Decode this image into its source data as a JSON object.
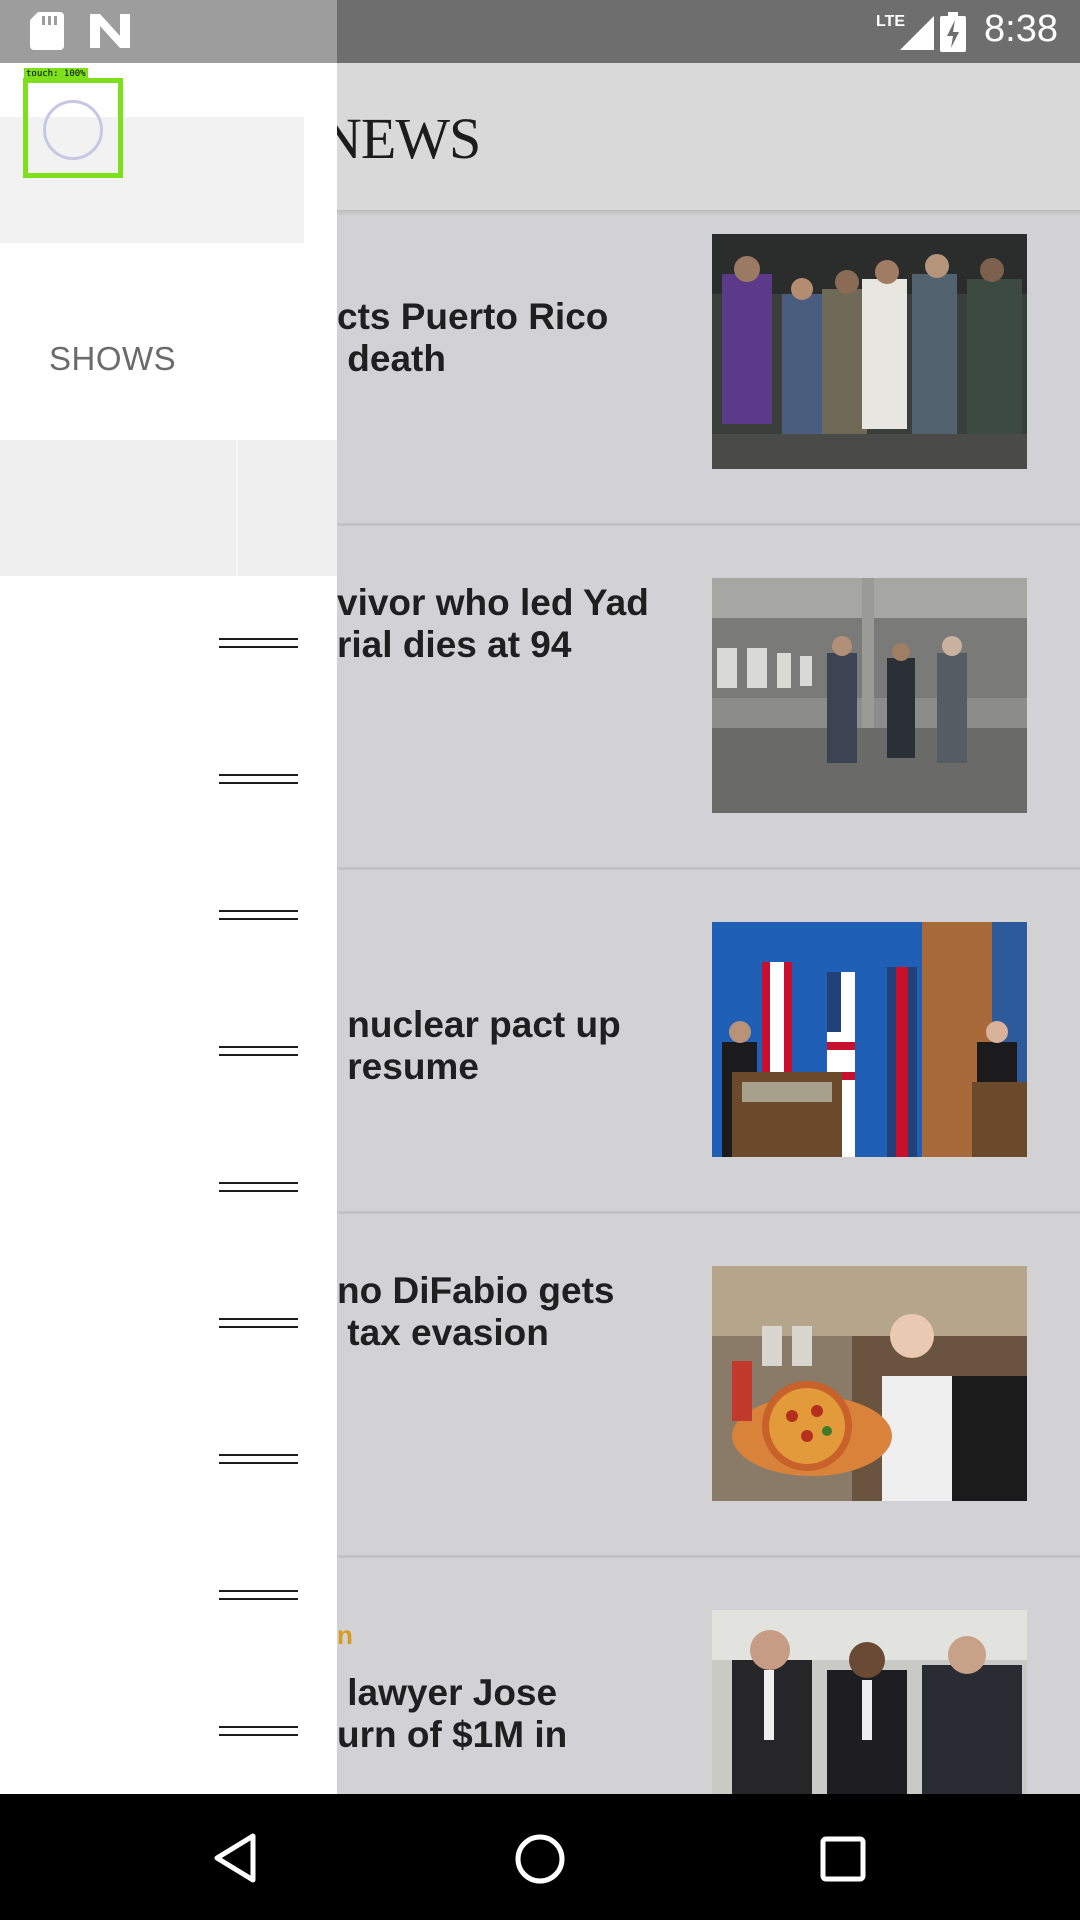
{
  "status_bar": {
    "time": "8:38",
    "network_label": "LTE",
    "icons": [
      "sd-card-icon",
      "n-logo-icon",
      "signal-icon",
      "battery-charging-icon"
    ]
  },
  "app": {
    "logo_text": "NEWS",
    "articles": [
      {
        "title": "cts Puerto Rico\n death",
        "tag": "",
        "image": "photo-crowd-embrace"
      },
      {
        "title": "vivor who led Yad\nrial dies at 94",
        "tag": "",
        "image": "photo-warehouse-men"
      },
      {
        "title": " nuclear pact up\n resume",
        "tag": "",
        "image": "photo-diplomats-flags"
      },
      {
        "title": "no DiFabio gets\n tax evasion",
        "tag": "",
        "image": "photo-pizza-chef"
      },
      {
        "title": " lawyer Jose\nurn of $1M in",
        "tag": "n",
        "image": "photo-court-men"
      }
    ]
  },
  "drawer": {
    "section_label": "SHOWS",
    "handle_count": 9
  },
  "touch_overlay": {
    "label": "touch: 100%"
  },
  "nav_bar": {
    "buttons": [
      "back",
      "home",
      "recents"
    ]
  }
}
